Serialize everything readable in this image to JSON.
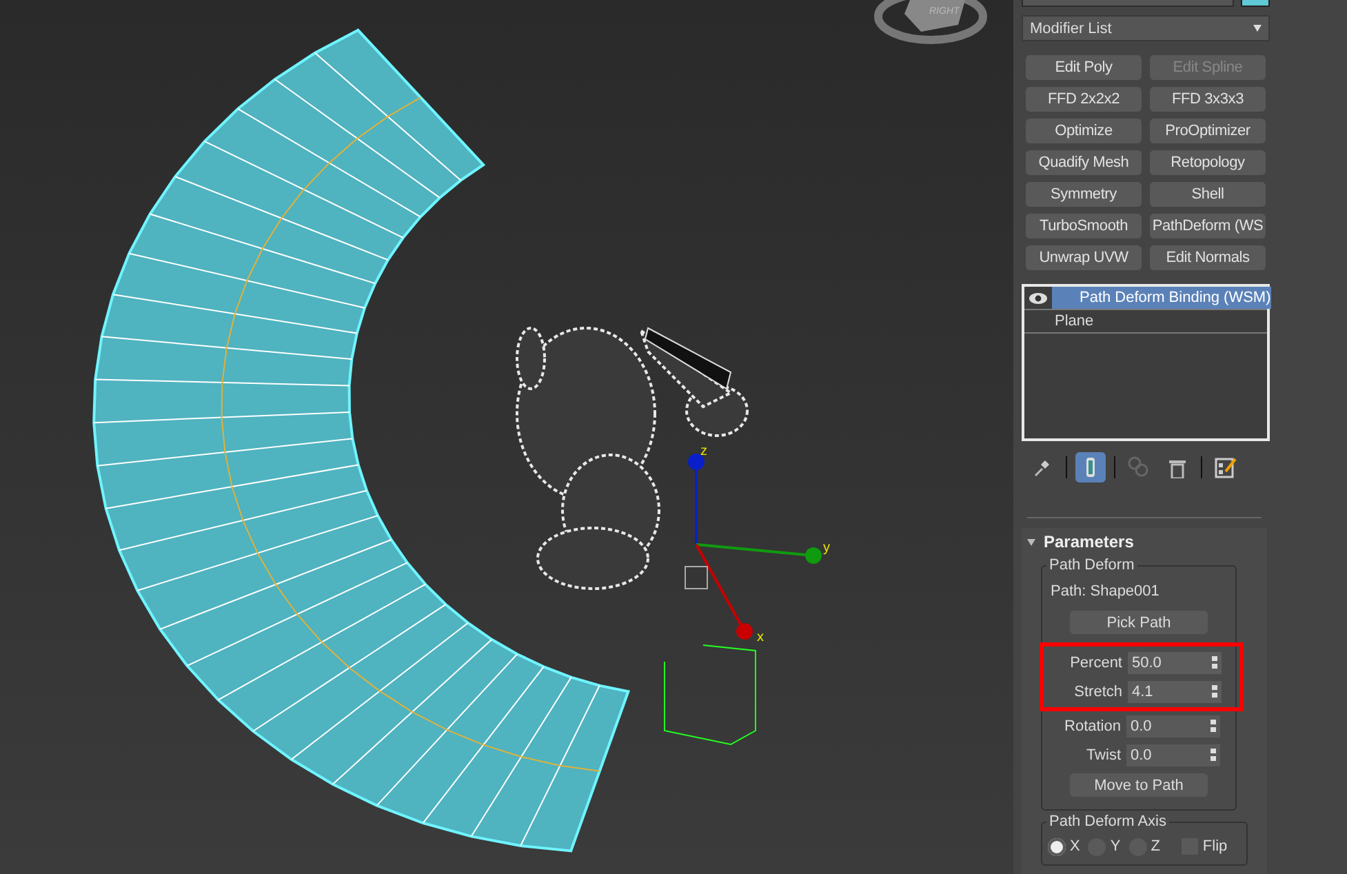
{
  "viewport": {
    "viewcube_label": "RIGHT",
    "gizmo_axes": [
      {
        "label": "z",
        "color": "#0a1fc8"
      },
      {
        "label": "y",
        "color": "#0f9a0f"
      },
      {
        "label": "x",
        "color": "#c80000"
      }
    ]
  },
  "panel": {
    "modifier_list": "Modifier List",
    "modifier_buttons": [
      {
        "label": "Edit Poly",
        "disabled": false
      },
      {
        "label": "Edit Spline",
        "disabled": true
      },
      {
        "label": "FFD 2x2x2",
        "disabled": false
      },
      {
        "label": "FFD 3x3x3",
        "disabled": false
      },
      {
        "label": "Optimize",
        "disabled": false
      },
      {
        "label": "ProOptimizer",
        "disabled": false
      },
      {
        "label": "Quadify Mesh",
        "disabled": false
      },
      {
        "label": "Retopology",
        "disabled": false
      },
      {
        "label": "Symmetry",
        "disabled": false
      },
      {
        "label": "Shell",
        "disabled": false
      },
      {
        "label": "TurboSmooth",
        "disabled": false
      },
      {
        "label": "PathDeform (WS",
        "disabled": false
      },
      {
        "label": "Unwrap UVW",
        "disabled": false
      },
      {
        "label": "Edit Normals",
        "disabled": false
      }
    ],
    "stack": [
      {
        "label": "Path Deform Binding (WSM)",
        "selected": true,
        "visible": true
      },
      {
        "label": "Plane",
        "selected": false,
        "visible": false
      }
    ],
    "stack_tools": [
      {
        "kind": "pin",
        "selected": false
      },
      {
        "kind": "show-end-result",
        "selected": true
      },
      {
        "kind": "make-unique",
        "selected": false
      },
      {
        "kind": "remove",
        "selected": false
      },
      {
        "kind": "configure",
        "selected": false
      }
    ],
    "rollout": {
      "title": "Parameters",
      "expanded": true,
      "group": "Path Deform",
      "path_label": "Path: Shape001",
      "pick_button": "Pick Path",
      "spinners": [
        {
          "label": "Percent",
          "value": "50.0",
          "highlighted": true
        },
        {
          "label": "Stretch",
          "value": "4.1",
          "highlighted": true
        },
        {
          "label": "Rotation",
          "value": "0.0",
          "highlighted": false
        },
        {
          "label": "Twist",
          "value": "0.0",
          "highlighted": false
        }
      ],
      "move_button": "Move to Path",
      "axis_group": {
        "title": "Path Deform Axis",
        "axes": [
          {
            "label": "X",
            "selected": true
          },
          {
            "label": "Y",
            "selected": false
          },
          {
            "label": "Z",
            "selected": false
          }
        ],
        "flip": {
          "label": "Flip",
          "checked": false
        }
      }
    }
  }
}
